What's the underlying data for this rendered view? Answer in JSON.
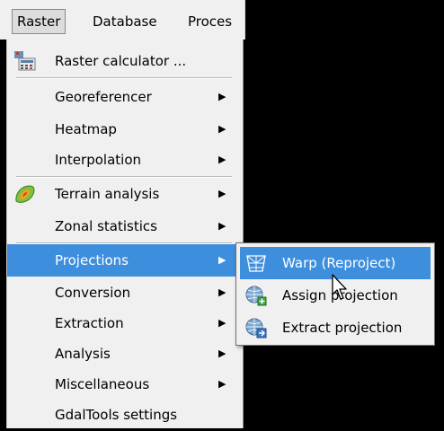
{
  "menubar": {
    "items": [
      "Raster",
      "Database",
      "Proces"
    ]
  },
  "menu": {
    "items": [
      {
        "label": "Raster calculator ..."
      },
      {
        "label": "Georeferencer"
      },
      {
        "label": "Heatmap"
      },
      {
        "label": "Interpolation"
      },
      {
        "label": "Terrain analysis"
      },
      {
        "label": "Zonal statistics"
      },
      {
        "label": "Projections"
      },
      {
        "label": "Conversion"
      },
      {
        "label": "Extraction"
      },
      {
        "label": "Analysis"
      },
      {
        "label": "Miscellaneous"
      },
      {
        "label": "GdalTools settings"
      }
    ],
    "arrow_glyph": "▶"
  },
  "submenu": {
    "items": [
      {
        "label": "Warp (Reproject)"
      },
      {
        "label": "Assign projection"
      },
      {
        "label": "Extract projection"
      }
    ]
  },
  "colors": {
    "highlight": "#3e8ede",
    "menu_bg": "#f0f0f0"
  }
}
